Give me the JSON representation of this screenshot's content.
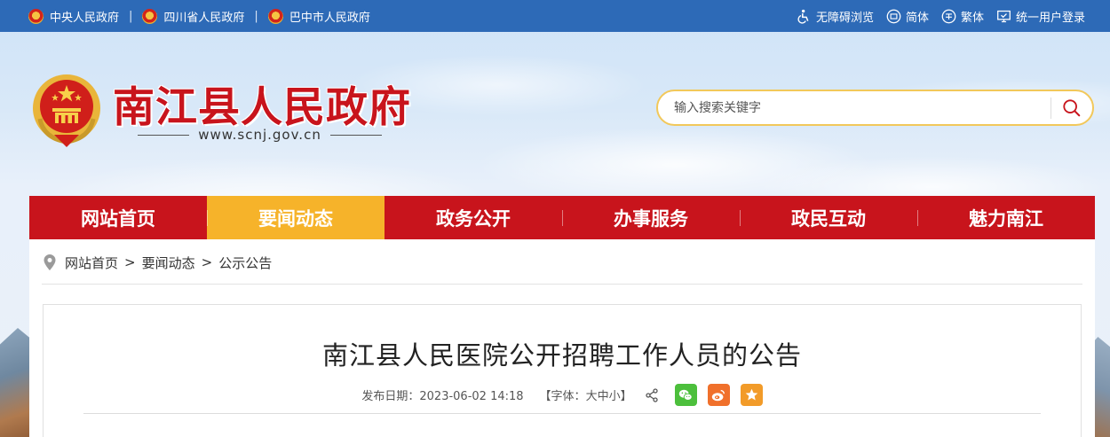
{
  "top_links": [
    {
      "label": "中央人民政府"
    },
    {
      "label": "四川省人民政府"
    },
    {
      "label": "巴中市人民政府"
    }
  ],
  "top_separator": "|",
  "tools": {
    "accessibility": "无障碍浏览",
    "simplified": "简体",
    "traditional": "繁体",
    "login": "统一用户登录"
  },
  "header": {
    "title": "南江县人民政府",
    "url": "www.scnj.gov.cn"
  },
  "search": {
    "placeholder": "输入搜索关键字"
  },
  "nav": [
    {
      "label": "网站首页"
    },
    {
      "label": "要闻动态",
      "active": true
    },
    {
      "label": "政务公开"
    },
    {
      "label": "办事服务"
    },
    {
      "label": "政民互动"
    },
    {
      "label": "魅力南江"
    }
  ],
  "breadcrumb": {
    "items": [
      "网站首页",
      "要闻动态",
      "公示公告"
    ],
    "separator": ">"
  },
  "article": {
    "title": "南江县人民医院公开招聘工作人员的公告",
    "publish_label": "发布日期：",
    "publish_date": "2023-06-02 14:18",
    "font_size_open": "【字体：",
    "font_large": "大",
    "font_medium": "中",
    "font_small": "小",
    "font_size_close": "】"
  },
  "colors": {
    "topbar": "#2d6ab7",
    "nav_red": "#c8141c",
    "nav_active": "#f6b32a",
    "title_red": "#c8141c",
    "wechat": "#4cbf3c",
    "weibo": "#f0702b",
    "favorite": "#f29b29"
  },
  "icons": {
    "top_link": "national-emblem-icon",
    "accessibility": "wheelchair-icon",
    "simplified": "simplified-chinese-icon",
    "traditional": "traditional-chinese-icon",
    "login": "monitor-check-icon",
    "search": "search-icon",
    "breadcrumb": "location-pin-icon",
    "share": "share-icon",
    "wechat": "wechat-icon",
    "weibo": "weibo-icon",
    "favorite": "star-icon"
  }
}
